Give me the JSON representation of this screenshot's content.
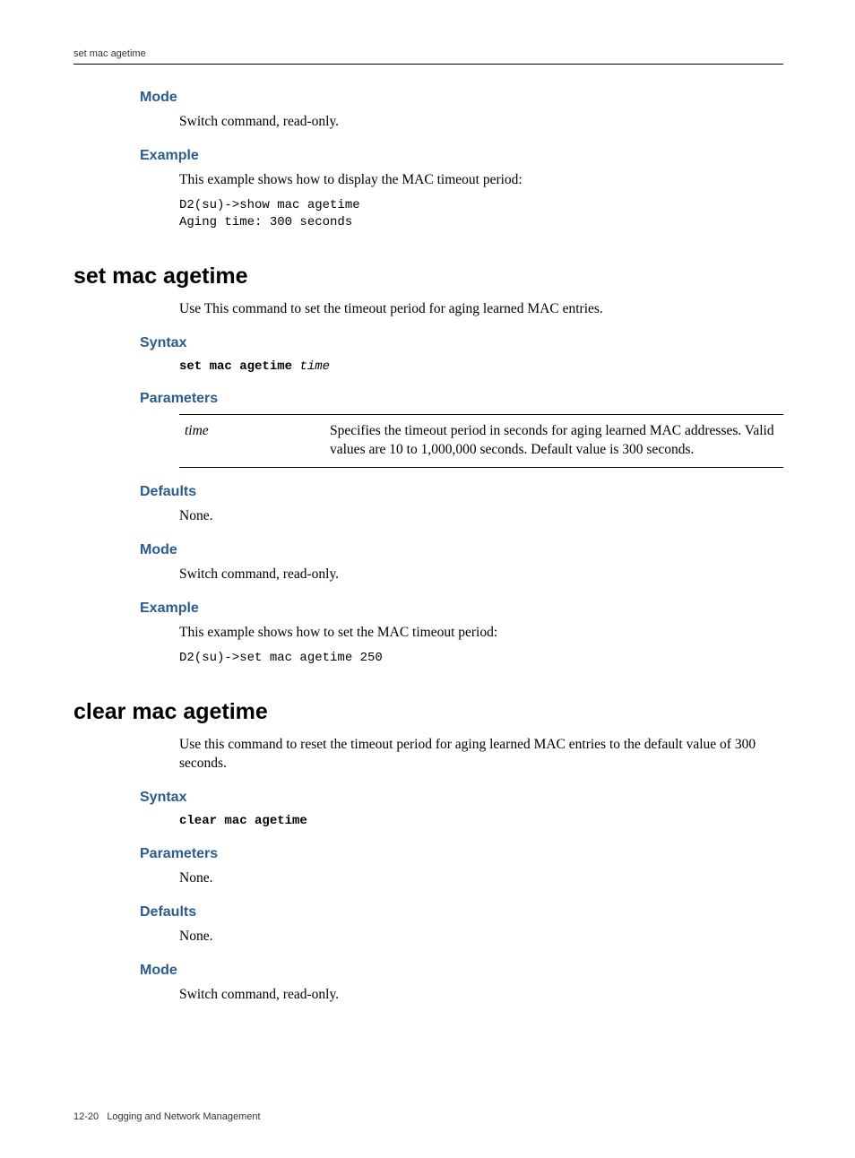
{
  "header": {
    "running": "set mac agetime"
  },
  "sec_show": {
    "mode_h": "Mode",
    "mode_txt": "Switch command, read-only.",
    "ex_h": "Example",
    "ex_txt": "This example shows how to display the MAC timeout period:",
    "ex_code": "D2(su)->show mac agetime\nAging time: 300 seconds"
  },
  "sec_set": {
    "title": "set mac agetime",
    "intro": "Use This command to set the timeout period for aging learned MAC entries.",
    "syntax_h": "Syntax",
    "syntax_cmd": "set mac agetime",
    "syntax_arg": "time",
    "params_h": "Parameters",
    "param_name": "time",
    "param_desc": "Specifies the timeout period in seconds for aging learned MAC addresses. Valid values are 10 to 1,000,000 seconds. Default value is 300 seconds.",
    "defaults_h": "Defaults",
    "defaults_txt": "None.",
    "mode_h": "Mode",
    "mode_txt": "Switch command, read-only.",
    "ex_h": "Example",
    "ex_txt": "This example shows how to set the MAC timeout period:",
    "ex_code": "D2(su)->set mac agetime 250"
  },
  "sec_clear": {
    "title": "clear mac agetime",
    "intro": "Use this command to reset the timeout period for aging learned MAC entries to the default value of 300 seconds.",
    "syntax_h": "Syntax",
    "syntax_cmd": "clear mac agetime",
    "params_h": "Parameters",
    "params_txt": "None.",
    "defaults_h": "Defaults",
    "defaults_txt": "None.",
    "mode_h": "Mode",
    "mode_txt": "Switch command, read-only."
  },
  "footer": {
    "page": "12-20",
    "chapter": "Logging and Network Management"
  }
}
